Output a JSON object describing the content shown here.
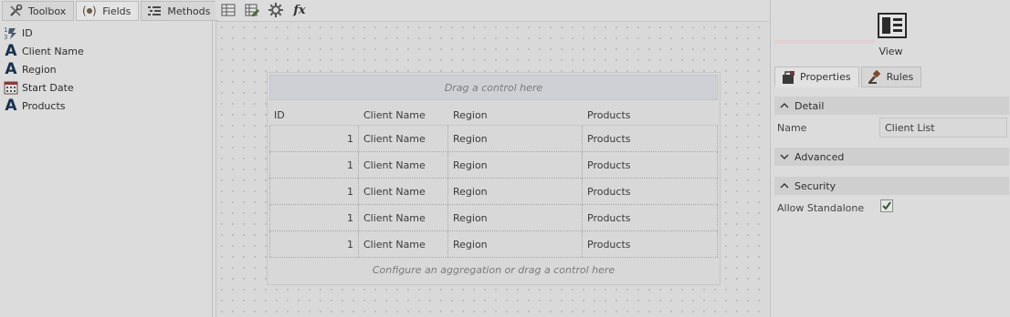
{
  "left_tabs": [
    {
      "label": "Toolbox",
      "icon": "toolbox-icon"
    },
    {
      "label": "Fields",
      "icon": "fields-icon"
    },
    {
      "label": "Methods",
      "icon": "methods-icon"
    }
  ],
  "fields": [
    {
      "label": "ID",
      "icon": "autonumber-icon"
    },
    {
      "label": "Client Name",
      "icon": "text-field-icon"
    },
    {
      "label": "Region",
      "icon": "text-field-icon"
    },
    {
      "label": "Start Date",
      "icon": "date-field-icon"
    },
    {
      "label": "Products",
      "icon": "text-field-icon"
    }
  ],
  "toolbar": {
    "buttons": [
      "table-icon",
      "edit-table-icon",
      "settings-icon",
      "expression-icon"
    ],
    "expression_label": "fx"
  },
  "list_view": {
    "drop_top": "Drag a control here",
    "drop_bottom": "Configure an aggregation or drag a control here",
    "columns": [
      "ID",
      "Client Name",
      "Region",
      "Products"
    ],
    "rows": [
      [
        "1",
        "Client Name",
        "Region",
        "Products"
      ],
      [
        "1",
        "Client Name",
        "Region",
        "Products"
      ],
      [
        "1",
        "Client Name",
        "Region",
        "Products"
      ],
      [
        "1",
        "Client Name",
        "Region",
        "Products"
      ],
      [
        "1",
        "Client Name",
        "Region",
        "Products"
      ]
    ]
  },
  "right": {
    "view_label": "View",
    "tabs": [
      {
        "label": "Properties",
        "icon": "properties-icon"
      },
      {
        "label": "Rules",
        "icon": "rules-icon"
      }
    ],
    "sections": {
      "detail": "Detail",
      "advanced": "Advanced",
      "security": "Security"
    },
    "name_label": "Name",
    "name_value": "Client List",
    "allow_standalone_label": "Allow Standalone",
    "allow_standalone_checked": true
  }
}
